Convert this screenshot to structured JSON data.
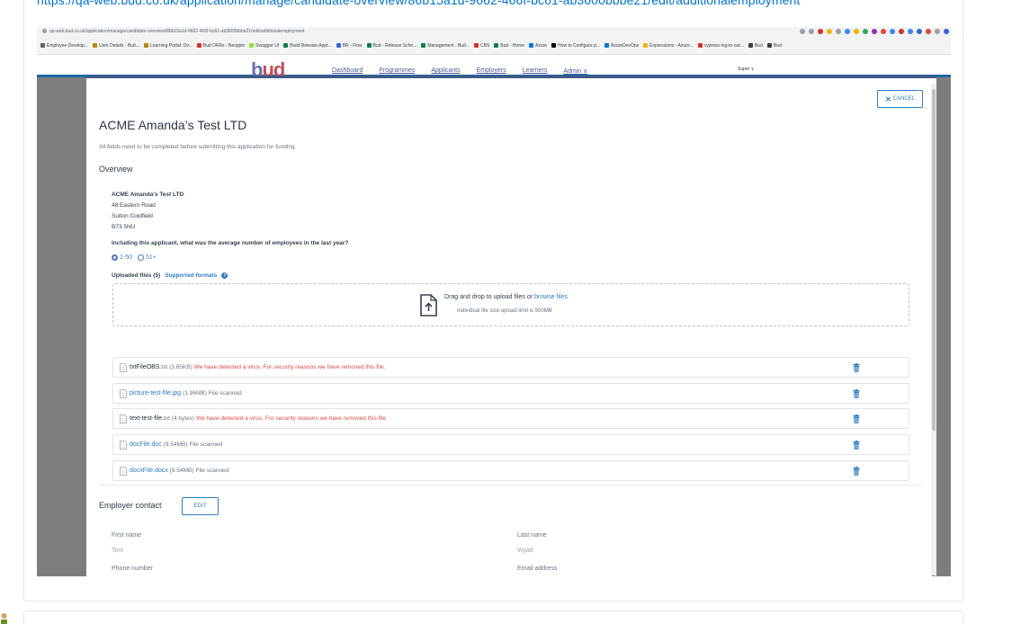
{
  "post": {
    "url_text": "https://qa-web.bud.co.uk/application/manage/candidate-overview/86b15a1d-9662-466f-bc61-ab3600bbbe21/edit/additionalemployment"
  },
  "browser": {
    "address": "qa-web.bud.co.uk/application/manage/candidate-overview/86b15a1d-9662-466f-bc61-ab3600bbbe21/edit/additionalemployment",
    "bookmarks": [
      {
        "label": "Employee Develop...",
        "color": "#5f6368"
      },
      {
        "label": "User Details - Bud...",
        "color": "#b8860b"
      },
      {
        "label": "Learning Portal: Ov...",
        "color": "#b8860b"
      },
      {
        "label": "Bud OKRs - Nexpptx",
        "color": "#d93025"
      },
      {
        "label": "Swagger UI",
        "color": "#85ea2d"
      },
      {
        "label": "Build Release Appr...",
        "color": "#0b8043"
      },
      {
        "label": "BR - Flow",
        "color": "#3367d6"
      },
      {
        "label": "Bud - Release Sche...",
        "color": "#0b8043"
      },
      {
        "label": "Management - Bud...",
        "color": "#0b8043"
      },
      {
        "label": "CBS",
        "color": "#d93025"
      },
      {
        "label": "Bud - Home",
        "color": "#0b8043"
      },
      {
        "label": "Azure",
        "color": "#0078d4"
      },
      {
        "label": "How to Configure p...",
        "color": "#000000"
      },
      {
        "label": "AzureDevOps",
        "color": "#0078d4"
      },
      {
        "label": "Expressions - Azure...",
        "color": "#f4b400"
      },
      {
        "label": "cypress-log-to-out...",
        "color": "#d93025"
      },
      {
        "label": "Bud",
        "color": "#3c4043"
      },
      {
        "label": "Bud",
        "color": "#3c4043"
      }
    ],
    "extension_colors": [
      "#9aa0a6",
      "#9aa0a6",
      "#d93025",
      "#f4b400",
      "#9aa0a6",
      "#4285f4",
      "#f4b400",
      "#34a853",
      "#9c27b0",
      "#ea4335",
      "#4285f4",
      "#d93025",
      "#4285f4",
      "#3367d6",
      "#ea4335",
      "#9aa0a6",
      "#3367d6"
    ]
  },
  "appnav": {
    "logo_b": "b",
    "logo_u": "u",
    "logo_d": "d",
    "links": [
      "Dashboard",
      "Programmes",
      "Applicants",
      "Employers",
      "Learners",
      "Admin ∨"
    ],
    "user": "Super ∨"
  },
  "modal": {
    "cancel_label": "CANCEL",
    "title": "ACME Amanda’s Test LTD",
    "subtitle": "All fields need to be completed before submitting this application for funding.",
    "overview_heading": "Overview",
    "company": {
      "name": "ACME Amanda's Test LTD",
      "address": [
        "48 Eastern Road",
        "Sutton Coldfield",
        "B73 5NU"
      ]
    },
    "employees_question": "Including this applicant, what was the average number of employees in the last year?",
    "employee_options": [
      {
        "label": "1-50",
        "selected": true
      },
      {
        "label": "51+",
        "selected": false
      }
    ],
    "uploaded_label": "Uploaded files (5)",
    "supported_formats": "Supported formats",
    "dropzone": {
      "text": "Drag and drop to upload files or",
      "browse": "browse files",
      "limit": "Individual file size upload limit is 500MB"
    },
    "files": [
      {
        "name": "txtFileOBS",
        "ext": ".txt",
        "size": "(3.85KB)",
        "status": "We have detected a virus. For security reasons we have removed this file.",
        "virus": true
      },
      {
        "name": "picture-test-file.jpg",
        "ext": "",
        "size": "(1.96MB)",
        "status": "File scanned",
        "virus": false
      },
      {
        "name": "text-test-file",
        "ext": ".txt",
        "size": "(4 bytes)",
        "status": "We have detected a virus. For security reasons we have removed this file.",
        "virus": true
      },
      {
        "name": "docFile.doc",
        "ext": "",
        "size": "(9.54MB)",
        "status": "File scanned",
        "virus": false
      },
      {
        "name": "docxFile.docx",
        "ext": "",
        "size": "(9.54MB)",
        "status": "File scanned",
        "virus": false
      }
    ],
    "employer_contact": {
      "heading": "Employer contact",
      "edit_label": "EDIT",
      "first_name_label": "First name",
      "first_name": "Tom",
      "last_name_label": "Last name",
      "last_name": "Wyatt",
      "phone_label": "Phone number",
      "email_label": "Email address"
    }
  }
}
